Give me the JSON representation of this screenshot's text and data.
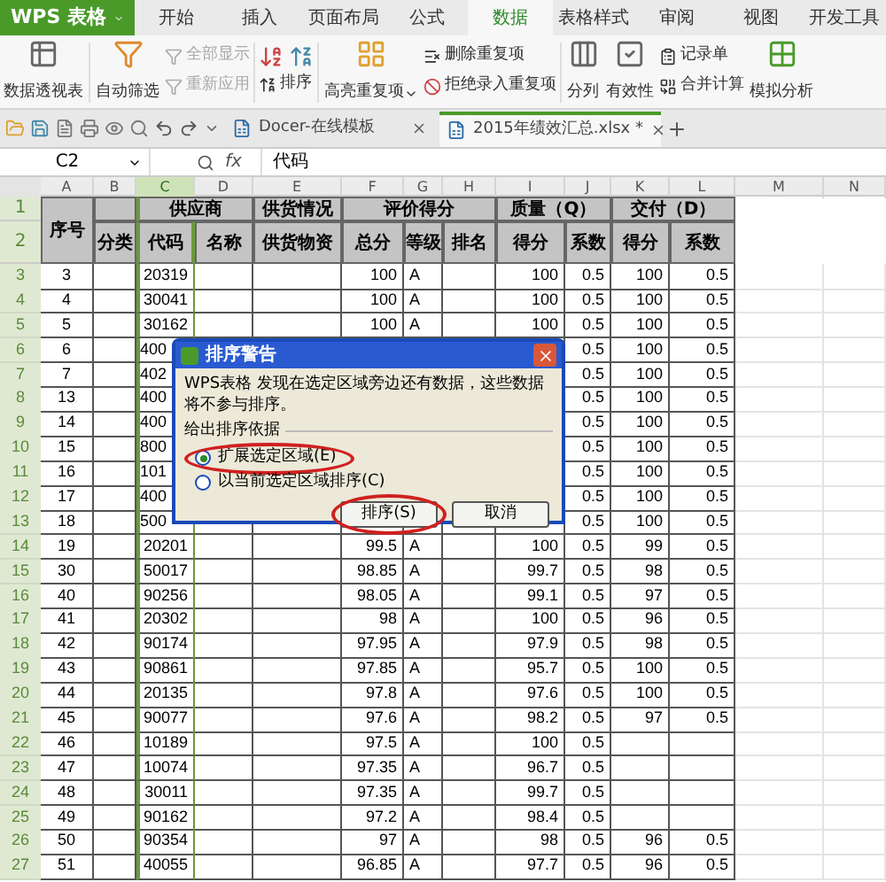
{
  "app_button": {
    "label": "WPS 表格"
  },
  "menu_tabs": [
    {
      "label": "开始",
      "selected": false
    },
    {
      "label": "插入",
      "selected": false
    },
    {
      "label": "页面布局",
      "selected": false
    },
    {
      "label": "公式",
      "selected": false
    },
    {
      "label": "数据",
      "selected": true
    },
    {
      "label": "表格样式",
      "selected": false
    },
    {
      "label": "审阅",
      "selected": false
    },
    {
      "label": "视图",
      "selected": false
    },
    {
      "label": "开发工具",
      "selected": false
    }
  ],
  "ribbon": {
    "pivot": "数据透视表",
    "auto_filter": "自动筛选",
    "show_all": {
      "label": "全部显示",
      "disabled": true
    },
    "reapply": {
      "label": "重新应用",
      "disabled": true
    },
    "sort": "排序",
    "highlight_dup": "高亮重复项",
    "remove_dup": "删除重复项",
    "reject_dup": "拒绝录入重复项",
    "split": "分列",
    "validity": "有效性",
    "record": "记录单",
    "consolidate": "合并计算",
    "simulate": "模拟分析"
  },
  "doc_tabs": [
    {
      "label": "Docer-在线模板",
      "selected": false
    },
    {
      "label": "2015年绩效汇总.xlsx *",
      "selected": true
    }
  ],
  "formula_bar": {
    "cell": "C2",
    "fx": "fx",
    "value": "代码"
  },
  "sheet": {
    "columns": [
      {
        "label": "A",
        "selected": false
      },
      {
        "label": "B",
        "selected": false
      },
      {
        "label": "C",
        "selected": true
      },
      {
        "label": "D",
        "selected": false
      },
      {
        "label": "E",
        "selected": false
      },
      {
        "label": "F",
        "selected": false
      },
      {
        "label": "G",
        "selected": false
      },
      {
        "label": "H",
        "selected": false
      },
      {
        "label": "I",
        "selected": false
      },
      {
        "label": "J",
        "selected": false
      },
      {
        "label": "K",
        "selected": false
      },
      {
        "label": "L",
        "selected": false
      },
      {
        "label": "M",
        "selected": false
      },
      {
        "label": "N",
        "selected": false
      }
    ],
    "header_row_numbers": [
      "1",
      "2"
    ],
    "group_labels": [
      "序号",
      "供应商",
      "供货情况",
      "评价得分",
      "质量（Q）",
      "交付（D）"
    ],
    "field_labels": [
      "分类",
      "代码",
      "名称",
      "供货物资",
      "总分",
      "等级",
      "排名",
      "得分",
      "系数",
      "得分",
      "系数"
    ],
    "rows": [
      {
        "number": "3",
        "a": "3",
        "c": "20319",
        "f": "100",
        "g": "A",
        "i": "100",
        "j": "0.5",
        "k": "100",
        "l": "0.5"
      },
      {
        "number": "4",
        "a": "4",
        "c": "30041",
        "f": "100",
        "g": "A",
        "i": "100",
        "j": "0.5",
        "k": "100",
        "l": "0.5"
      },
      {
        "number": "5",
        "a": "5",
        "c": "30162",
        "f": "100",
        "g": "A",
        "i": "100",
        "j": "0.5",
        "k": "100",
        "l": "0.5"
      },
      {
        "number": "6",
        "a": "6",
        "c": "400",
        "partial": true,
        "j": "0.5",
        "k": "100",
        "l": "0.5"
      },
      {
        "number": "7",
        "a": "7",
        "c": "402",
        "partial": true,
        "j": "0.5",
        "k": "100",
        "l": "0.5"
      },
      {
        "number": "8",
        "a": "13",
        "c": "400",
        "partial": true,
        "j": "0.5",
        "k": "100",
        "l": "0.5"
      },
      {
        "number": "9",
        "a": "14",
        "c": "400",
        "partial": true,
        "j": "0.5",
        "k": "100",
        "l": "0.5"
      },
      {
        "number": "10",
        "a": "15",
        "c": "800",
        "partial": true,
        "j": "0.5",
        "k": "100",
        "l": "0.5"
      },
      {
        "number": "11",
        "a": "16",
        "c": "101",
        "partial": true,
        "j": "0.5",
        "k": "100",
        "l": "0.5"
      },
      {
        "number": "12",
        "a": "17",
        "c": "400",
        "partial": true,
        "j": "0.5",
        "k": "100",
        "l": "0.5"
      },
      {
        "number": "13",
        "a": "18",
        "c": "500",
        "partial": true,
        "j": "0.5",
        "k": "100",
        "l": "0.5"
      },
      {
        "number": "14",
        "a": "19",
        "c": "20201",
        "f": "99.5",
        "g": "A",
        "i": "100",
        "j": "0.5",
        "k": "99",
        "l": "0.5"
      },
      {
        "number": "15",
        "a": "30",
        "c": "50017",
        "f": "98.85",
        "g": "A",
        "i": "99.7",
        "j": "0.5",
        "k": "98",
        "l": "0.5"
      },
      {
        "number": "16",
        "a": "40",
        "c": "90256",
        "f": "98.05",
        "g": "A",
        "i": "99.1",
        "j": "0.5",
        "k": "97",
        "l": "0.5"
      },
      {
        "number": "17",
        "a": "41",
        "c": "20302",
        "f": "98",
        "g": "A",
        "i": "100",
        "j": "0.5",
        "k": "96",
        "l": "0.5"
      },
      {
        "number": "18",
        "a": "42",
        "c": "90174",
        "f": "97.95",
        "g": "A",
        "i": "97.9",
        "j": "0.5",
        "k": "98",
        "l": "0.5"
      },
      {
        "number": "19",
        "a": "43",
        "c": "90861",
        "f": "97.85",
        "g": "A",
        "i": "95.7",
        "j": "0.5",
        "k": "100",
        "l": "0.5"
      },
      {
        "number": "20",
        "a": "44",
        "c": "20135",
        "f": "97.8",
        "g": "A",
        "i": "97.6",
        "j": "0.5",
        "k": "100",
        "l": "0.5"
      },
      {
        "number": "21",
        "a": "45",
        "c": "90077",
        "f": "97.6",
        "g": "A",
        "i": "98.2",
        "j": "0.5",
        "k": "97",
        "l": "0.5"
      },
      {
        "number": "22",
        "a": "46",
        "c": "10189",
        "f": "97.5",
        "g": "A",
        "i": "100",
        "j": "0.5"
      },
      {
        "number": "23",
        "a": "47",
        "c": "10074",
        "f": "97.35",
        "g": "A",
        "i": "96.7",
        "j": "0.5"
      },
      {
        "number": "24",
        "a": "48",
        "c": "30011",
        "f": "97.35",
        "g": "A",
        "i": "99.7",
        "j": "0.5"
      },
      {
        "number": "25",
        "a": "49",
        "c": "90162",
        "f": "97.2",
        "g": "A",
        "i": "98.4",
        "j": "0.5"
      },
      {
        "number": "26",
        "a": "50",
        "c": "90354",
        "f": "97",
        "g": "A",
        "i": "98",
        "j": "0.5",
        "k": "96",
        "l": "0.5"
      },
      {
        "number": "27",
        "a": "51",
        "c": "40055",
        "f": "96.85",
        "g": "A",
        "i": "97.7",
        "j": "0.5",
        "k": "96",
        "l": "0.5"
      }
    ]
  },
  "dialog": {
    "title": "排序警告",
    "message": "WPS表格 发现在选定区域旁边还有数据，这些数据将不参与排序。",
    "group_label": "给出排序依据",
    "options": [
      {
        "label": "扩展选定区域(E)",
        "selected": true,
        "circled": true
      },
      {
        "label": "以当前选定区域排序(C)",
        "selected": false,
        "circled": false
      }
    ],
    "buttons": [
      {
        "label": "排序(S)",
        "circled": true
      },
      {
        "label": "取消",
        "circled": false
      }
    ]
  }
}
